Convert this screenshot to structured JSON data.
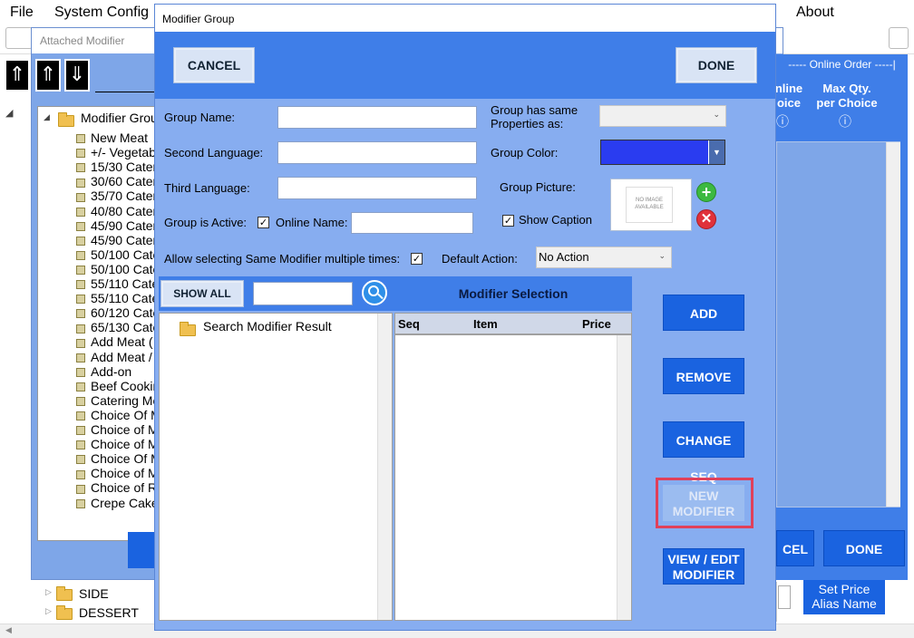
{
  "menubar": {
    "file": "File",
    "system_config": "System Config",
    "about": "About"
  },
  "background_tree": {
    "items": [
      "SIDE",
      "DESSERT"
    ]
  },
  "attached_window": {
    "title": "Attached Modifier",
    "root_folder": "Modifier Grou",
    "items": [
      "New Meat",
      "+/- Vegetab",
      "15/30 Cater",
      "30/60 Cater",
      "35/70 Cater",
      "40/80 Cater",
      "45/90 Cater",
      "45/90 Cater",
      "50/100 Cate",
      "50/100 Cate",
      "55/110 Cate",
      "55/110 Cate",
      "60/120 Cate",
      "65/130 Cate",
      "Add Meat (",
      "Add Meat /",
      "Add-on",
      "Beef Cookin",
      "Catering Me",
      "Choice Of M",
      "Choice of M",
      "Choice of M",
      "Choice Of M",
      "Choice of M",
      "Choice of R",
      "Crepe Cake"
    ]
  },
  "online_order": {
    "header": "----- Online Order -----|",
    "col1": "nline\noice",
    "col2": "Max Qty.\nper Choice",
    "info_icon": "ⓘ",
    "cancel_label": "CEL",
    "done_label": "DONE",
    "set_price_label": "Set Price\nAlias Name"
  },
  "dialog": {
    "title": "Modifier Group",
    "cancel_label": "CANCEL",
    "done_label": "DONE",
    "group_name_label": "Group Name:",
    "second_language_label": "Second Language:",
    "third_language_label": "Third Language:",
    "group_active_label": "Group is Active:",
    "online_name_label": "Online Name:",
    "same_properties_label": "Group has same\nProperties as:",
    "group_color_label": "Group Color:",
    "group_color": "#2a3cf0",
    "group_picture_label": "Group Picture:",
    "no_image_text": "NO IMAGE\nAVAILABLE",
    "show_caption_label": "Show Caption",
    "allow_multiple_label": "Allow selecting Same Modifier multiple times:",
    "default_action_label": "Default Action:",
    "default_action_value": "No Action",
    "show_all_label": "SHOW ALL",
    "search_result_label": "Search Modifier Result",
    "modifier_selection_label": "Modifier Selection",
    "columns": {
      "seq": "Seq",
      "item": "Item",
      "price": "Price"
    },
    "add_label": "ADD",
    "remove_label": "REMOVE",
    "change_seq_label": "CHANGE SEQ",
    "new_modifier_label": "NEW\nMODIFIER",
    "view_edit_label": "VIEW / EDIT\nMODIFIER"
  }
}
